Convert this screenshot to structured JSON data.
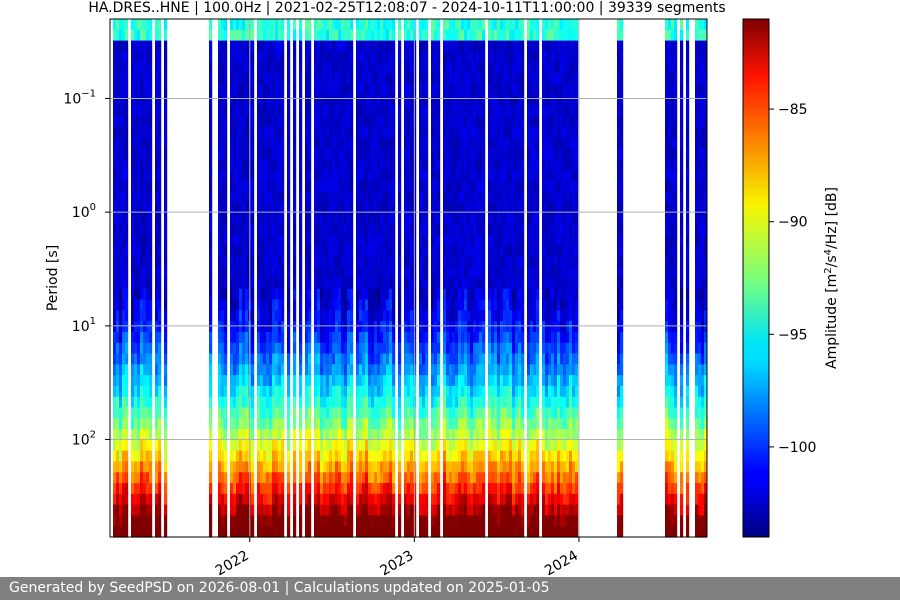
{
  "chart_data": {
    "type": "heatmap",
    "title": "HA.DRES..HNE | 100.0Hz | 2021-02-25T12:08:07 - 2024-10-11T11:00:00 | 39339 segments",
    "xlabel": "",
    "ylabel": "Period [s]",
    "y_scale": "log",
    "y_inverted": true,
    "ylim": [
      0.02,
      720
    ],
    "yticks": [
      {
        "value": 0.1,
        "base": "10",
        "exp": "−1"
      },
      {
        "value": 1,
        "base": "10",
        "exp": "0"
      },
      {
        "value": 10,
        "base": "10",
        "exp": "1"
      },
      {
        "value": 100,
        "base": "10",
        "exp": "2"
      }
    ],
    "xlim": [
      "2021-02-25",
      "2024-10-11"
    ],
    "xticks": [
      {
        "value": "2022-01-01",
        "label": "2022"
      },
      {
        "value": "2023-01-01",
        "label": "2023"
      },
      {
        "value": "2024-01-01",
        "label": "2024"
      }
    ],
    "grid": true,
    "colormap": "jet",
    "colorbar": {
      "label": "Amplitude [m²/s⁴/Hz] [dB]",
      "range": [
        -104,
        -81
      ],
      "ticks": [
        -85,
        -90,
        -95,
        -100
      ]
    },
    "data_gaps": [
      [
        "2021-07-01",
        "2021-10-01"
      ],
      [
        "2024-01-01",
        "2024-03-25"
      ],
      [
        "2024-04-05",
        "2024-07-10"
      ]
    ],
    "colors": {
      "grid": "#b0b0b0"
    }
  },
  "footer": {
    "text": "Generated by SeedPSD on 2026-08-01 | Calculations updated on 2025-01-05"
  }
}
